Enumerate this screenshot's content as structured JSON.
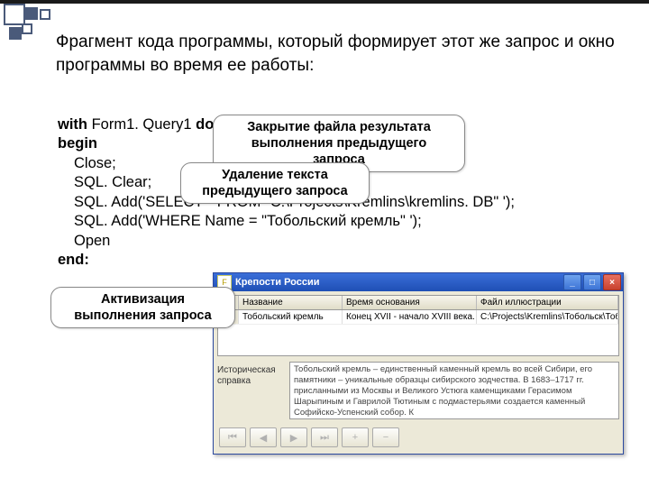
{
  "heading": "Фрагмент кода программы, который формирует этот же запрос и окно программы во время ее работы:",
  "code": {
    "l1a": "with",
    "l1b": " Form1. Query1 ",
    "l1c": "do",
    "l2": "begin",
    "l3": "Close;",
    "l4": "SQL. Clear;",
    "l5": "SQL. Add('SELECT * FROM \"C:\\Projects\\Kremlins\\kremlins. DB\" ');",
    "l6": "SQL. Add('WHERE Name = \"Тобольский кремль\" ');",
    "l7": "Open",
    "l8": "end:"
  },
  "callouts": {
    "c1": "Закрытие файла результата выполнения предыдущего запроса",
    "c2": "Удаление текста предыдущего запроса",
    "c3": "Активизация выполнения запроса"
  },
  "window": {
    "icon_letter": "F",
    "title": "Крепости России",
    "headers": {
      "h1": "Название",
      "h2": "Время основания",
      "h3": "Файл иллюстрации"
    },
    "row": {
      "name": "Тобольский кремль",
      "time": "Конец XVII - начало XVIII века.",
      "file": "C:\\Projects\\Kremlins\\Тобольск\\Тобол"
    },
    "hist_label": "Историческая справка",
    "memo": "Тобольский кремль – единственный каменный кремль во всей Сибири, его памятники – уникальные образцы сибирского зодчества. В 1683–1717 гг. присланными из Москвы и Великого Устюга каменщиками Герасимом Шарыпиным и Гаврилой Тютиным с подмастерьями создается каменный Софийско-Успенский собор. К",
    "nav": {
      "first": "⏮",
      "prev": "◀",
      "next": "▶",
      "last": "⏭",
      "plus": "+",
      "minus": "−"
    }
  }
}
